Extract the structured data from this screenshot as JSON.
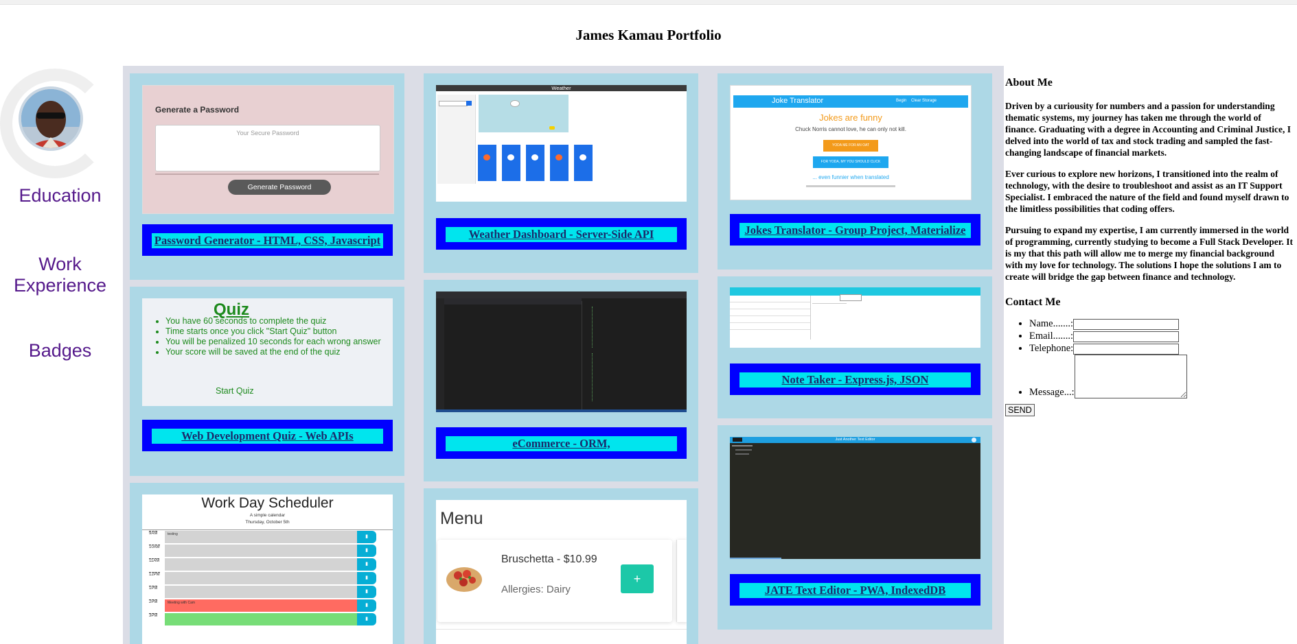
{
  "page": {
    "title": "James Kamau Portfolio"
  },
  "sidebar": {
    "links": [
      {
        "label": "Education"
      },
      {
        "label": "Work"
      },
      {
        "label": "Experience"
      },
      {
        "label": "Badges"
      }
    ]
  },
  "projects": [
    {
      "link": "Password Generator - HTML, CSS, Javascript"
    },
    {
      "link": "Web Development Quiz - Web APIs"
    },
    {
      "link": "Weather Dashboard - Server-Side API"
    },
    {
      "link": "eCommerce - ORM,"
    },
    {
      "link": "Jokes Translator - Group Project, Materialize"
    },
    {
      "link": "Note Taker - Express.js, JSON"
    },
    {
      "link": "JATE Text Editor - PWA, IndexedDB"
    }
  ],
  "shots": {
    "password": {
      "heading": "Generate a Password",
      "placeholder": "Your Secure Password",
      "button": "Generate Password"
    },
    "quiz": {
      "title": "Quiz",
      "bullets": [
        "You have 60 seconds to complete the quiz",
        "Time starts once you click \"Start Quiz\" button",
        "You will be penalized 10 seconds for each wrong answer",
        "Your score will be saved at the end of the quiz"
      ],
      "start": "Start Quiz"
    },
    "scheduler": {
      "title": "Work Day Scheduler",
      "subtitle": "A simple calendar",
      "date": "Thursday, October 5th",
      "hours": [
        "9AM",
        "10AM",
        "11AM",
        "12PM",
        "1PM",
        "2PM",
        "3PM"
      ],
      "first_note": "testing",
      "meeting": "Meeting with Cam"
    },
    "weather": {
      "header": "Weather"
    },
    "menu": {
      "title": "Menu",
      "item": "Bruschetta - $10.99",
      "allergies": "Allergies: Dairy",
      "add": "+"
    },
    "jokes": {
      "brand": "Joke Translator",
      "nav1": "Begin",
      "nav2": "Clear Storage",
      "headline": "Jokes are funny",
      "quote": "Chuck Norris cannot love, he can only not kill.",
      "btn1": "YODA ME FOR AN OAT",
      "btn2": "FOR YODA, MY YOU SHOULD CLICK",
      "tagline": "... even funnier when translated"
    },
    "jate": {
      "header": "Just Another Text Editor"
    }
  },
  "about": {
    "heading": "About Me",
    "paragraphs": [
      "Driven by a curiousity for numbers and a passion for understanding thematic systems, my journey has taken me through the world of finance. Graduating with a degree in Accounting and Criminal Justice, I delved into the world of tax and stock trading and sampled the fast-changing landscape of financial markets.",
      "Ever curious to explore new horizons, I transitioned into the realm of technology, with the desire to troubleshoot and assist as an IT Support Specialist. I embraced the nature of the field and found myself drawn to the limitless possibilities that coding offers.",
      "Pursuing to expand my expertise, I am currently immersed in the world of programming, currently studying to become a Full Stack Developer. It is my that this path will allow me to merge my financial background with my love for technology. The solutions I hope the solutions I am to create will bridge the gap between finance and technology."
    ]
  },
  "contact": {
    "heading": "Contact Me",
    "name_label": "Name.......:",
    "email_label": "Email.......:",
    "phone_label": "Telephone:",
    "message_label": "Message...:",
    "send": "SEND"
  }
}
